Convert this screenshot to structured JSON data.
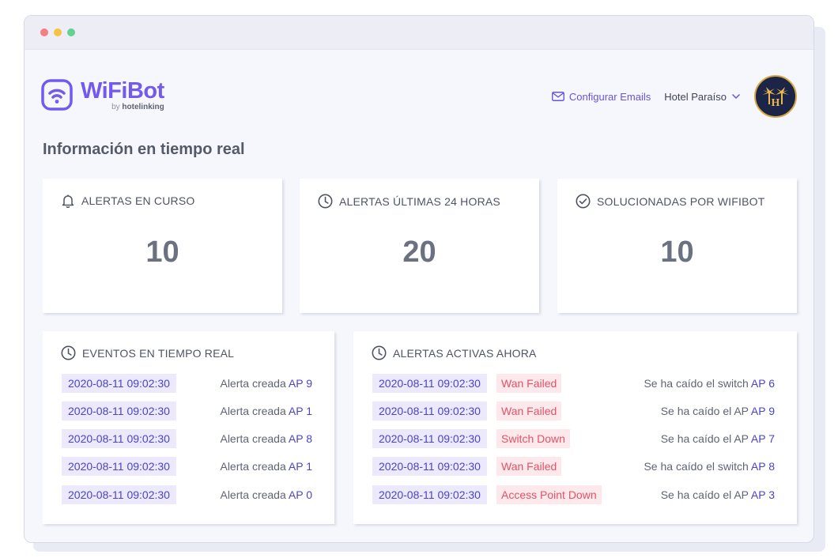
{
  "header": {
    "logo_name": "WiFiBot",
    "logo_by": "by",
    "logo_brand": "hotelinking",
    "email_link": "Configurar Emails",
    "hotel_name": "Hotel Paraíso",
    "avatar_letter": "H"
  },
  "page_title": "Información en tiempo real",
  "stats": [
    {
      "label": "ALERTAS EN CURSO",
      "value": "10",
      "icon": "bell-icon"
    },
    {
      "label": "ALERTAS ÚLTIMAS 24 HORAS",
      "value": "20",
      "icon": "clock-icon"
    },
    {
      "label": "SOLUCIONADAS POR WIFIBOT",
      "value": "10",
      "icon": "check-circle-icon"
    }
  ],
  "events": {
    "title": "EVENTOS EN TIEMPO REAL",
    "rows": [
      {
        "date": "2020-08-11 09:02:30",
        "text": "Alerta creada",
        "ap": "AP 9"
      },
      {
        "date": "2020-08-11 09:02:30",
        "text": "Alerta creada",
        "ap": "AP 1"
      },
      {
        "date": "2020-08-11 09:02:30",
        "text": "Alerta creada",
        "ap": "AP 8"
      },
      {
        "date": "2020-08-11 09:02:30",
        "text": "Alerta creada",
        "ap": "AP 1"
      },
      {
        "date": "2020-08-11 09:02:30",
        "text": "Alerta creada",
        "ap": "AP 0"
      }
    ]
  },
  "alerts": {
    "title": "ALERTAS ACTIVAS AHORA",
    "rows": [
      {
        "date": "2020-08-11 09:02:30",
        "type": "Wan Failed",
        "text": "Se ha caído el switch",
        "ap": "AP 6"
      },
      {
        "date": "2020-08-11 09:02:30",
        "type": "Wan Failed",
        "text": "Se ha caído el AP",
        "ap": "AP 9"
      },
      {
        "date": "2020-08-11 09:02:30",
        "type": "Switch Down",
        "text": "Se ha caído el AP",
        "ap": "AP 7"
      },
      {
        "date": "2020-08-11 09:02:30",
        "type": "Wan Failed",
        "text": "Se ha caído el switch",
        "ap": "AP 8"
      },
      {
        "date": "2020-08-11 09:02:30",
        "type": "Access Point Down",
        "text": "Se ha caído el AP",
        "ap": "AP 3"
      }
    ]
  },
  "colors": {
    "brand": "#7459f0",
    "date_badge_bg": "#ebe9fb",
    "alert_badge_bg": "#fde9ec",
    "alert_badge_text": "#e05367"
  }
}
